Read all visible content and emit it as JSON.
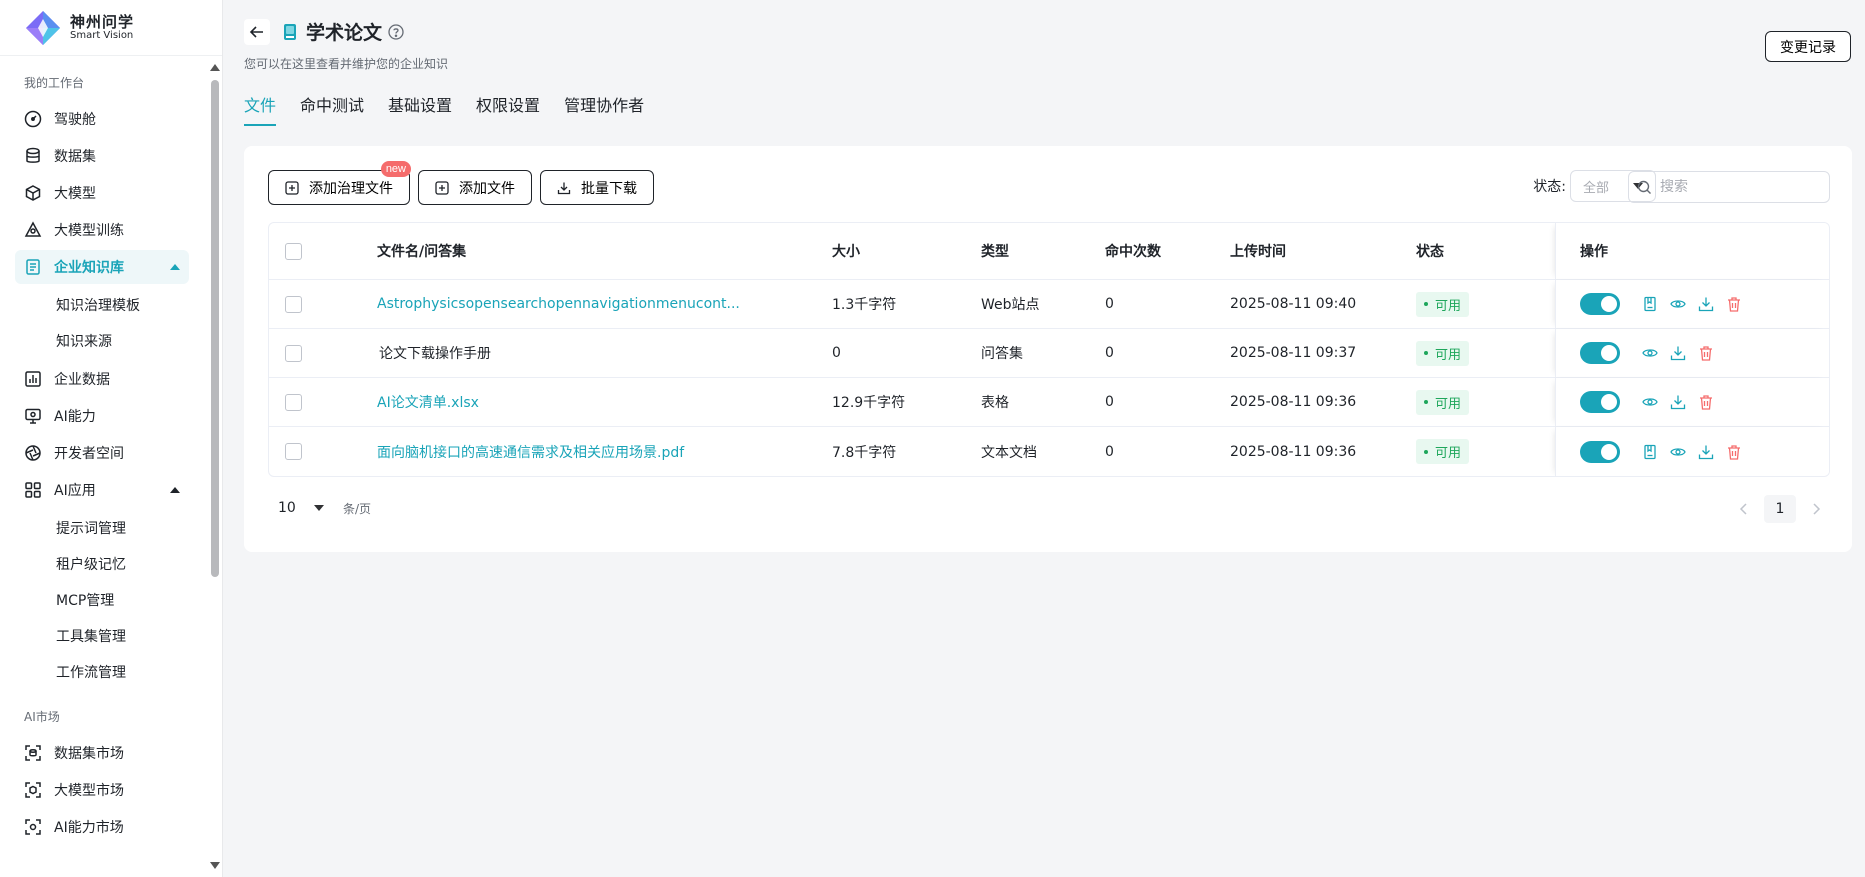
{
  "brand": {
    "name_cn": "神州问学",
    "name_en": "Smart Vision"
  },
  "sidebar": {
    "section_workspace": "我的工作台",
    "items": [
      {
        "label": "驾驶舱"
      },
      {
        "label": "数据集"
      },
      {
        "label": "大模型"
      },
      {
        "label": "大模型训练"
      },
      {
        "label": "企业知识库"
      },
      {
        "label": "企业数据"
      },
      {
        "label": "AI能力"
      },
      {
        "label": "开发者空间"
      },
      {
        "label": "AI应用"
      }
    ],
    "kb_sub": [
      "知识治理模板",
      "知识来源"
    ],
    "ai_app_sub": [
      "提示词管理",
      "租户级记忆",
      "MCP管理",
      "工具集管理",
      "工作流管理"
    ],
    "section_market": "AI市场",
    "market_items": [
      {
        "label": "数据集市场"
      },
      {
        "label": "大模型市场"
      },
      {
        "label": "AI能力市场"
      }
    ]
  },
  "header": {
    "title": "学术论文",
    "subtitle": "您可以在这里查看并维护您的企业知识",
    "history_button": "变更记录"
  },
  "tabs": [
    "文件",
    "命中测试",
    "基础设置",
    "权限设置",
    "管理协作者"
  ],
  "toolbar": {
    "add_governed": "添加治理文件",
    "new_badge": "new",
    "add_file": "添加文件",
    "batch_download": "批量下载",
    "status_label": "状态:",
    "status_value": "全部",
    "search_placeholder": "搜索"
  },
  "table": {
    "columns": [
      "文件名/问答集",
      "大小",
      "类型",
      "命中次数",
      "上传时间",
      "状态",
      "操作"
    ],
    "rows": [
      {
        "name": "Astrophysicsopensearchopennavigationmenucont...",
        "size": "1.3千字符",
        "type": "Web站点",
        "hits": "0",
        "time": "2025-08-11 09:40",
        "status": "可用",
        "link": true,
        "has_book": true
      },
      {
        "name": "论文下载操作手册",
        "size": "0",
        "type": "问答集",
        "hits": "0",
        "time": "2025-08-11 09:37",
        "status": "可用",
        "link": false,
        "has_book": false
      },
      {
        "name": "AI论文清单.xlsx",
        "size": "12.9千字符",
        "type": "表格",
        "hits": "0",
        "time": "2025-08-11 09:36",
        "status": "可用",
        "link": true,
        "has_book": false
      },
      {
        "name": "面向脑机接口的高速通信需求及相关应用场景.pdf",
        "size": "7.8千字符",
        "type": "文本文档",
        "hits": "0",
        "time": "2025-08-11 09:36",
        "status": "可用",
        "link": true,
        "has_book": true
      }
    ]
  },
  "pagination": {
    "page_size": "10",
    "per_page_label": "条/页",
    "current_page": "1"
  },
  "colors": {
    "accent": "#1aa4b8",
    "success": "#1ea65b",
    "danger": "#f56c6c"
  }
}
